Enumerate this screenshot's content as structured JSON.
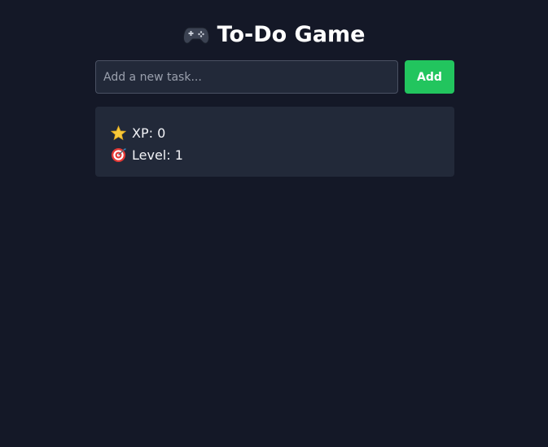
{
  "app": {
    "title": "To-Do Game",
    "title_icon": "gamepad-icon"
  },
  "task_form": {
    "placeholder": "Add a new task...",
    "value": "",
    "add_label": "Add",
    "add_color": "#22c55e"
  },
  "stats": {
    "xp_text": "XP: 0",
    "xp_icon": "star-icon",
    "level_text": "Level: 1",
    "level_icon": "target-icon"
  },
  "colors": {
    "background": "#141827",
    "card": "#222939",
    "accent": "#22c55e"
  }
}
